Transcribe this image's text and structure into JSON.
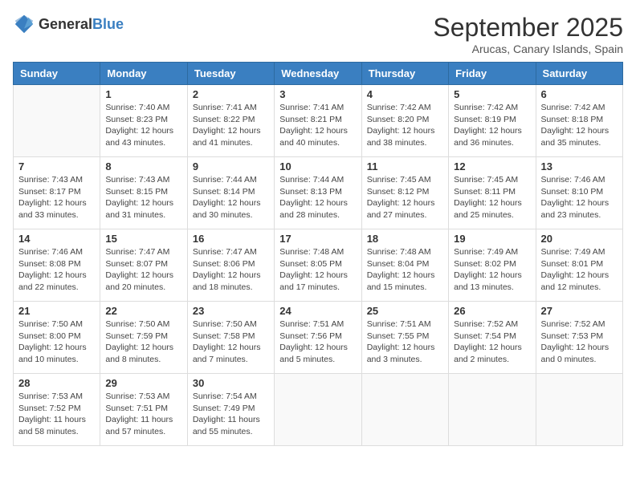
{
  "logo": {
    "general": "General",
    "blue": "Blue"
  },
  "header": {
    "month": "September 2025",
    "location": "Arucas, Canary Islands, Spain"
  },
  "weekdays": [
    "Sunday",
    "Monday",
    "Tuesday",
    "Wednesday",
    "Thursday",
    "Friday",
    "Saturday"
  ],
  "weeks": [
    [
      {
        "day": "",
        "info": ""
      },
      {
        "day": "1",
        "info": "Sunrise: 7:40 AM\nSunset: 8:23 PM\nDaylight: 12 hours\nand 43 minutes."
      },
      {
        "day": "2",
        "info": "Sunrise: 7:41 AM\nSunset: 8:22 PM\nDaylight: 12 hours\nand 41 minutes."
      },
      {
        "day": "3",
        "info": "Sunrise: 7:41 AM\nSunset: 8:21 PM\nDaylight: 12 hours\nand 40 minutes."
      },
      {
        "day": "4",
        "info": "Sunrise: 7:42 AM\nSunset: 8:20 PM\nDaylight: 12 hours\nand 38 minutes."
      },
      {
        "day": "5",
        "info": "Sunrise: 7:42 AM\nSunset: 8:19 PM\nDaylight: 12 hours\nand 36 minutes."
      },
      {
        "day": "6",
        "info": "Sunrise: 7:42 AM\nSunset: 8:18 PM\nDaylight: 12 hours\nand 35 minutes."
      }
    ],
    [
      {
        "day": "7",
        "info": "Sunrise: 7:43 AM\nSunset: 8:17 PM\nDaylight: 12 hours\nand 33 minutes."
      },
      {
        "day": "8",
        "info": "Sunrise: 7:43 AM\nSunset: 8:15 PM\nDaylight: 12 hours\nand 31 minutes."
      },
      {
        "day": "9",
        "info": "Sunrise: 7:44 AM\nSunset: 8:14 PM\nDaylight: 12 hours\nand 30 minutes."
      },
      {
        "day": "10",
        "info": "Sunrise: 7:44 AM\nSunset: 8:13 PM\nDaylight: 12 hours\nand 28 minutes."
      },
      {
        "day": "11",
        "info": "Sunrise: 7:45 AM\nSunset: 8:12 PM\nDaylight: 12 hours\nand 27 minutes."
      },
      {
        "day": "12",
        "info": "Sunrise: 7:45 AM\nSunset: 8:11 PM\nDaylight: 12 hours\nand 25 minutes."
      },
      {
        "day": "13",
        "info": "Sunrise: 7:46 AM\nSunset: 8:10 PM\nDaylight: 12 hours\nand 23 minutes."
      }
    ],
    [
      {
        "day": "14",
        "info": "Sunrise: 7:46 AM\nSunset: 8:08 PM\nDaylight: 12 hours\nand 22 minutes."
      },
      {
        "day": "15",
        "info": "Sunrise: 7:47 AM\nSunset: 8:07 PM\nDaylight: 12 hours\nand 20 minutes."
      },
      {
        "day": "16",
        "info": "Sunrise: 7:47 AM\nSunset: 8:06 PM\nDaylight: 12 hours\nand 18 minutes."
      },
      {
        "day": "17",
        "info": "Sunrise: 7:48 AM\nSunset: 8:05 PM\nDaylight: 12 hours\nand 17 minutes."
      },
      {
        "day": "18",
        "info": "Sunrise: 7:48 AM\nSunset: 8:04 PM\nDaylight: 12 hours\nand 15 minutes."
      },
      {
        "day": "19",
        "info": "Sunrise: 7:49 AM\nSunset: 8:02 PM\nDaylight: 12 hours\nand 13 minutes."
      },
      {
        "day": "20",
        "info": "Sunrise: 7:49 AM\nSunset: 8:01 PM\nDaylight: 12 hours\nand 12 minutes."
      }
    ],
    [
      {
        "day": "21",
        "info": "Sunrise: 7:50 AM\nSunset: 8:00 PM\nDaylight: 12 hours\nand 10 minutes."
      },
      {
        "day": "22",
        "info": "Sunrise: 7:50 AM\nSunset: 7:59 PM\nDaylight: 12 hours\nand 8 minutes."
      },
      {
        "day": "23",
        "info": "Sunrise: 7:50 AM\nSunset: 7:58 PM\nDaylight: 12 hours\nand 7 minutes."
      },
      {
        "day": "24",
        "info": "Sunrise: 7:51 AM\nSunset: 7:56 PM\nDaylight: 12 hours\nand 5 minutes."
      },
      {
        "day": "25",
        "info": "Sunrise: 7:51 AM\nSunset: 7:55 PM\nDaylight: 12 hours\nand 3 minutes."
      },
      {
        "day": "26",
        "info": "Sunrise: 7:52 AM\nSunset: 7:54 PM\nDaylight: 12 hours\nand 2 minutes."
      },
      {
        "day": "27",
        "info": "Sunrise: 7:52 AM\nSunset: 7:53 PM\nDaylight: 12 hours\nand 0 minutes."
      }
    ],
    [
      {
        "day": "28",
        "info": "Sunrise: 7:53 AM\nSunset: 7:52 PM\nDaylight: 11 hours\nand 58 minutes."
      },
      {
        "day": "29",
        "info": "Sunrise: 7:53 AM\nSunset: 7:51 PM\nDaylight: 11 hours\nand 57 minutes."
      },
      {
        "day": "30",
        "info": "Sunrise: 7:54 AM\nSunset: 7:49 PM\nDaylight: 11 hours\nand 55 minutes."
      },
      {
        "day": "",
        "info": ""
      },
      {
        "day": "",
        "info": ""
      },
      {
        "day": "",
        "info": ""
      },
      {
        "day": "",
        "info": ""
      }
    ]
  ]
}
